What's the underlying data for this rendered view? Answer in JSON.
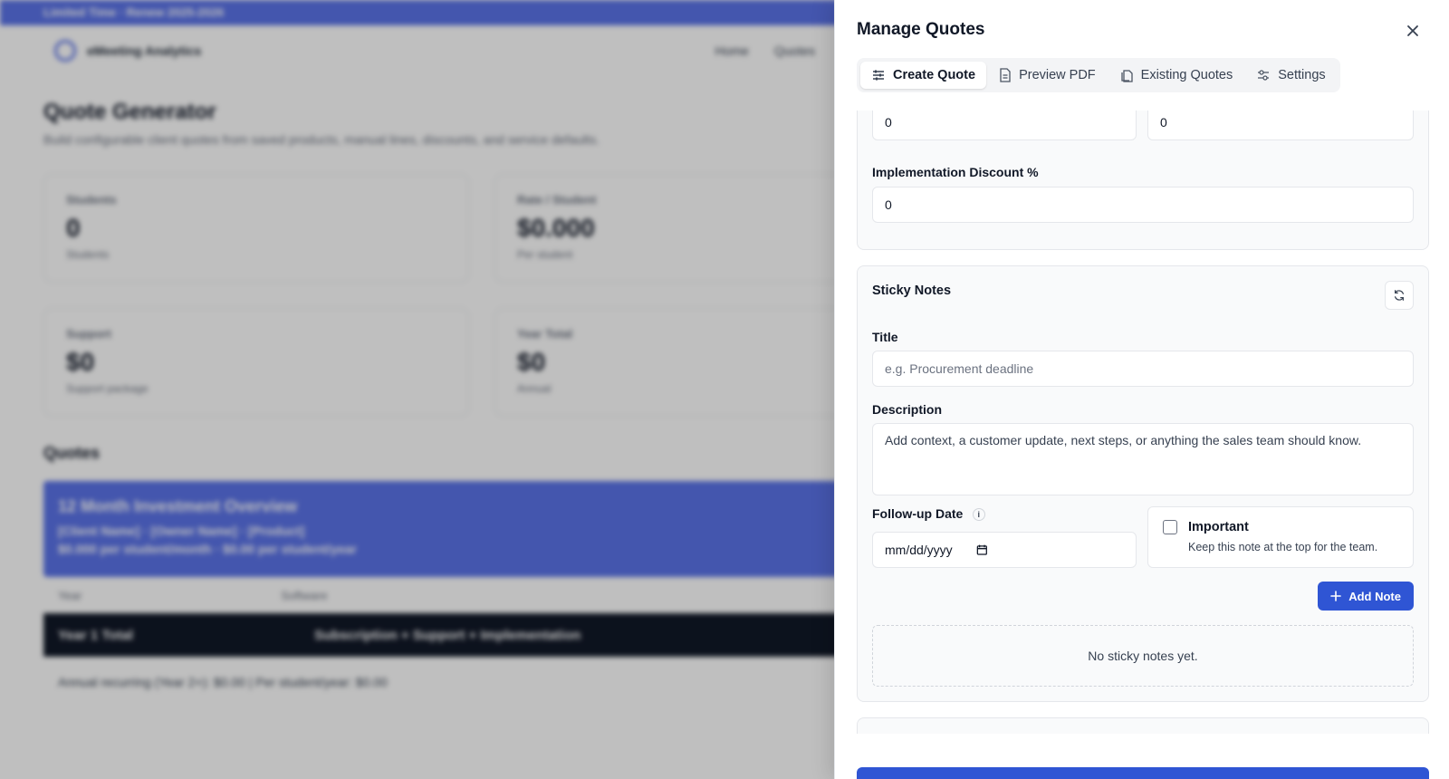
{
  "background": {
    "banner": "Limited Time · Renew 2025-2026",
    "brand": "eMeeting Analytics",
    "nav": [
      "Home",
      "Quotes"
    ],
    "title": "Quote Generator",
    "subtitle": "Build configurable client quotes from saved products, manual lines, discounts, and service defaults.",
    "cards": [
      {
        "label": "Students",
        "value": "0",
        "hint": "Students"
      },
      {
        "label": "Rate / Student",
        "value": "$0.000",
        "hint": "Per student"
      },
      {
        "label": "Support",
        "value": "$0",
        "hint": "Support package"
      },
      {
        "label": "Year Total",
        "value": "$0",
        "hint": "Annual"
      }
    ],
    "section": "Quotes",
    "overview_title": "12 Month Investment Overview",
    "overview_line1": "[Client Name] · [Owner Name] · [Product]",
    "overview_line2": "$0.000 per student/month · $0.00 per student/year",
    "table_headers": [
      "Year",
      "Software"
    ],
    "table_row": [
      "Year 1 Total",
      "Subscription + Support + Implementation"
    ],
    "footer": "Annual recurring (Year 2+): $0.00 | Per student/year: $0.00"
  },
  "drawer": {
    "title": "Manage Quotes",
    "tabs": [
      {
        "label": "Create Quote",
        "icon": "sliders-icon",
        "active": true
      },
      {
        "label": "Preview PDF",
        "icon": "file-icon",
        "active": false
      },
      {
        "label": "Existing Quotes",
        "icon": "files-icon",
        "active": false
      },
      {
        "label": "Settings",
        "icon": "settings-icon",
        "active": false
      }
    ]
  },
  "discounts": {
    "field_left_value": "0",
    "field_right_value": "0",
    "impl_label": "Implementation Discount %",
    "impl_value": "0"
  },
  "sticky": {
    "title": "Sticky Notes",
    "title_label": "Title",
    "title_placeholder": "e.g. Procurement deadline",
    "desc_label": "Description",
    "desc_placeholder": "Add context, a customer update, next steps, or anything the sales team should know.",
    "followup_label": "Follow-up Date",
    "followup_info": "i",
    "date_placeholder": "mm/dd/yyyy",
    "important_label": "Important",
    "important_hint": "Keep this note at the top for the team.",
    "important_checked": false,
    "add_button": "Add Note",
    "empty": "No sticky notes yet."
  },
  "colors": {
    "primary": "#2f55d4",
    "banner": "#5b73e8"
  }
}
